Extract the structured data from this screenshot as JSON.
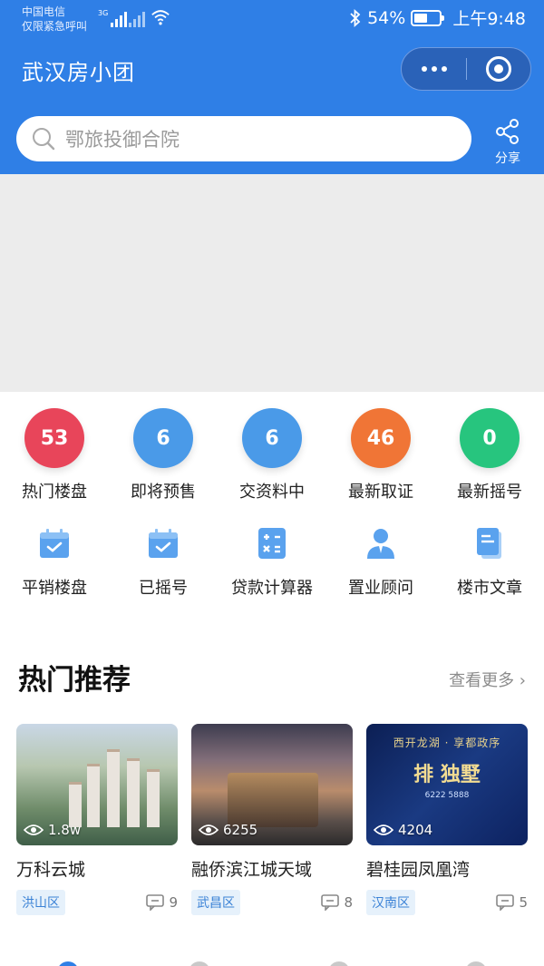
{
  "status": {
    "carrier_line1": "中国电信",
    "carrier_line2": "仅限紧急呼叫",
    "network": "3G",
    "battery": "54%",
    "battery_level": 0.54,
    "time": "上午9:48"
  },
  "header": {
    "title": "武汉房小团",
    "more_icon": "more-dots-icon",
    "close_icon": "target-close-icon"
  },
  "search": {
    "placeholder": "鄂旅投御合院",
    "share_label": "分享"
  },
  "stats": [
    {
      "count": "53",
      "label": "热门楼盘",
      "color": "#e8455a"
    },
    {
      "count": "6",
      "label": "即将预售",
      "color": "#4a9ae8"
    },
    {
      "count": "6",
      "label": "交资料中",
      "color": "#4a9ae8"
    },
    {
      "count": "46",
      "label": "最新取证",
      "color": "#f07536"
    },
    {
      "count": "0",
      "label": "最新摇号",
      "color": "#27c57e"
    }
  ],
  "tools": [
    {
      "label": "平销楼盘",
      "icon": "calendar-check-icon"
    },
    {
      "label": "已摇号",
      "icon": "calendar-check-icon"
    },
    {
      "label": "贷款计算器",
      "icon": "calculator-icon"
    },
    {
      "label": "置业顾问",
      "icon": "person-icon"
    },
    {
      "label": "楼市文章",
      "icon": "document-icon"
    }
  ],
  "section": {
    "title": "热门推荐",
    "more": "查看更多 ›"
  },
  "cards": [
    {
      "name": "万科云城",
      "views": "1.8w",
      "district": "洪山区",
      "comments": "9"
    },
    {
      "name": "融侨滨江城天域",
      "views": "6255",
      "district": "武昌区",
      "comments": "8"
    },
    {
      "name": "碧桂园凤凰湾",
      "views": "4204",
      "district": "汉南区",
      "comments": "5",
      "poster_top": "西开龙湖 · 享都政序",
      "poster_main": "排 独墅",
      "poster_sub": "6222 5888"
    }
  ],
  "colors": {
    "brand_blue": "#2f7fe6",
    "tag_blue": "#3b82d6"
  }
}
